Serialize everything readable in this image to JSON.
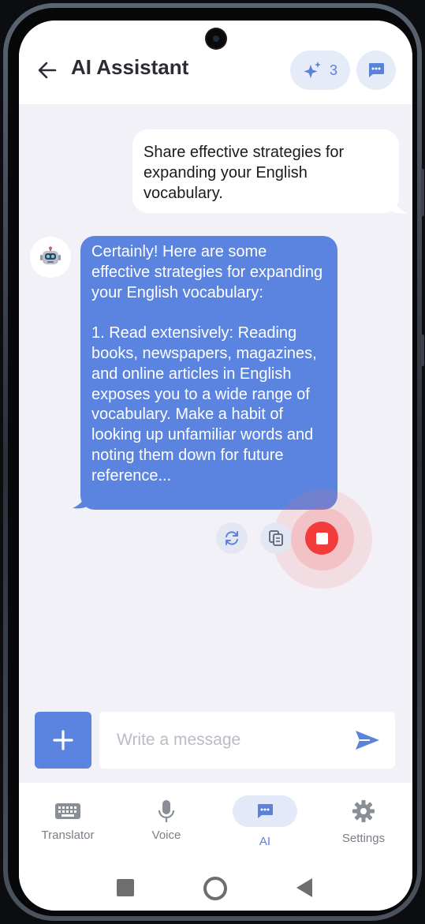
{
  "header": {
    "title": "AI Assistant",
    "credits_count": "3",
    "icons": {
      "back": "arrow-left-icon",
      "credits": "sparkles-icon",
      "chats": "chat-bubble-icon"
    }
  },
  "messages": {
    "user": "Share effective strategies for expanding your English vocabulary.",
    "assistant": "Certainly! Here are some effective strategies for expanding your English vocabulary:\n\n1. Read extensively: Reading books, newspapers, magazines, and online articles in English exposes you to a wide range of vocabulary. Make a habit of looking up unfamiliar words and noting them down for future reference..."
  },
  "message_actions": {
    "icons": [
      "refresh-icon",
      "copy-icon",
      "stop-icon"
    ],
    "stop_color": "#f23b3b"
  },
  "composer": {
    "placeholder": "Write a message",
    "icons": {
      "add": "plus-icon",
      "send": "send-icon"
    }
  },
  "bottom_nav": {
    "items": [
      {
        "label": "Translator",
        "icon": "keyboard-icon"
      },
      {
        "label": "Voice",
        "icon": "microphone-icon"
      },
      {
        "label": "AI",
        "icon": "chat-bubble-icon",
        "active": true
      },
      {
        "label": "Settings",
        "icon": "gear-icon"
      }
    ]
  },
  "colors": {
    "accent": "#5a84e0",
    "chat_background": "#f2f1f7",
    "user_bubble": "#ffffff",
    "assistant_bubble": "#5a84e0"
  }
}
